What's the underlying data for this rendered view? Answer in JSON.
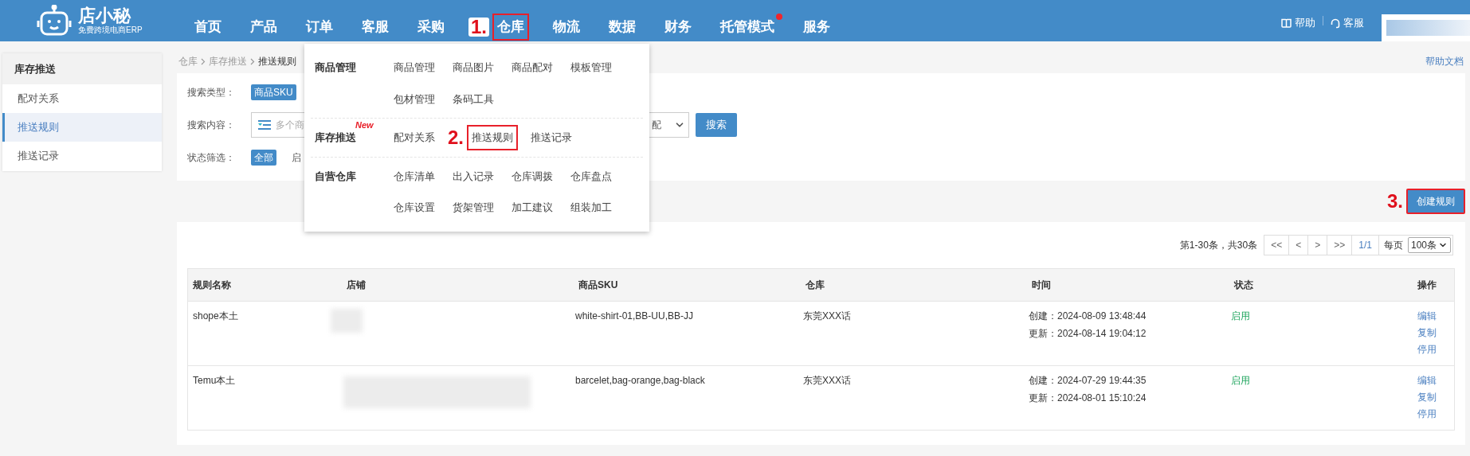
{
  "logo": {
    "name": "店小秘",
    "tagline": "免费跨境电商ERP"
  },
  "nav": [
    {
      "label": "首页",
      "highlighted": false,
      "dot": false
    },
    {
      "label": "产品",
      "highlighted": false,
      "dot": false
    },
    {
      "label": "订单",
      "highlighted": false,
      "dot": false
    },
    {
      "label": "客服",
      "highlighted": false,
      "dot": false
    },
    {
      "label": "采购",
      "highlighted": false,
      "dot": false
    },
    {
      "label": "仓库",
      "highlighted": true,
      "dot": false,
      "annotation": "1."
    },
    {
      "label": "物流",
      "highlighted": false,
      "dot": false
    },
    {
      "label": "数据",
      "highlighted": false,
      "dot": false
    },
    {
      "label": "财务",
      "highlighted": false,
      "dot": false
    },
    {
      "label": "托管模式",
      "highlighted": false,
      "dot": true
    },
    {
      "label": "服务",
      "highlighted": false,
      "dot": false
    }
  ],
  "header_links": [
    {
      "label": "帮助",
      "kind": "help"
    },
    {
      "label": "客服",
      "kind": "service"
    }
  ],
  "sidebar": {
    "title": "库存推送",
    "items": [
      {
        "label": "配对关系",
        "selected": false
      },
      {
        "label": "推送规则",
        "selected": true
      },
      {
        "label": "推送记录",
        "selected": false
      }
    ]
  },
  "breadcrumb": [
    "仓库",
    "库存推送",
    "推送规则"
  ],
  "help_doc": "帮助文档",
  "search": {
    "type_label": "搜索类型：",
    "type_value": "商品SKU",
    "content_label": "搜索内容：",
    "placeholder": "多个商",
    "match_value": "配",
    "button": "搜索",
    "status_label": "状态筛选：",
    "status_options": [
      {
        "label": "全部",
        "selected": true
      },
      {
        "label": "启",
        "selected": false
      }
    ]
  },
  "dropdown": {
    "groups": [
      {
        "title": "商品管理",
        "rows": [
          [
            {
              "label": "商品管理",
              "highlighted": false
            },
            {
              "label": "商品图片",
              "highlighted": false
            },
            {
              "label": "商品配对",
              "highlighted": false
            },
            {
              "label": "模板管理",
              "highlighted": false
            }
          ],
          [
            {
              "label": "包材管理",
              "highlighted": false
            },
            {
              "label": "条码工具",
              "highlighted": false
            }
          ]
        ]
      },
      {
        "title": "库存推送",
        "badge": "New",
        "rows": [
          [
            {
              "label": "配对关系",
              "highlighted": false
            },
            {
              "label": "推送规则",
              "highlighted": true,
              "annotation": "2."
            },
            {
              "label": "推送记录",
              "highlighted": false
            }
          ]
        ]
      },
      {
        "title": "自营仓库",
        "rows": [
          [
            {
              "label": "仓库清单",
              "highlighted": false
            },
            {
              "label": "出入记录",
              "highlighted": false
            },
            {
              "label": "仓库调拨",
              "highlighted": false
            },
            {
              "label": "仓库盘点",
              "highlighted": false
            }
          ],
          [
            {
              "label": "仓库设置",
              "highlighted": false
            },
            {
              "label": "货架管理",
              "highlighted": false
            },
            {
              "label": "加工建议",
              "highlighted": false
            },
            {
              "label": "组装加工",
              "highlighted": false
            }
          ]
        ]
      }
    ]
  },
  "create_button": {
    "label": "创建规则",
    "highlighted": true,
    "annotation": "3."
  },
  "pagination": {
    "summary": "第1-30条，共30条",
    "buttons": [
      "<<",
      "<",
      ">",
      ">>"
    ],
    "page": "1/1",
    "per_page_label": "每页",
    "per_page": "100条"
  },
  "table": {
    "columns": [
      "规则名称",
      "店铺",
      "商品SKU",
      "仓库",
      "时间",
      "状态",
      "操作"
    ],
    "rows": [
      {
        "name": "shope本土",
        "skus": "white-shirt-01,BB-UU,BB-JJ",
        "warehouse": "东莞XXX话",
        "created": "创建：2024-08-09 13:48:44",
        "updated": "更新：2024-08-14 19:04:12",
        "status": "启用",
        "enabled": true,
        "actions": [
          "编辑",
          "复制",
          "停用"
        ]
      },
      {
        "name": "Temu本土",
        "skus": "barcelet,bag-orange,bag-black",
        "warehouse": "东莞XXX话",
        "created": "创建：2024-07-29 19:44:35",
        "updated": "更新：2024-08-01 15:10:24",
        "status": "启用",
        "enabled": true,
        "actions": [
          "编辑",
          "复制",
          "停用"
        ]
      }
    ]
  }
}
